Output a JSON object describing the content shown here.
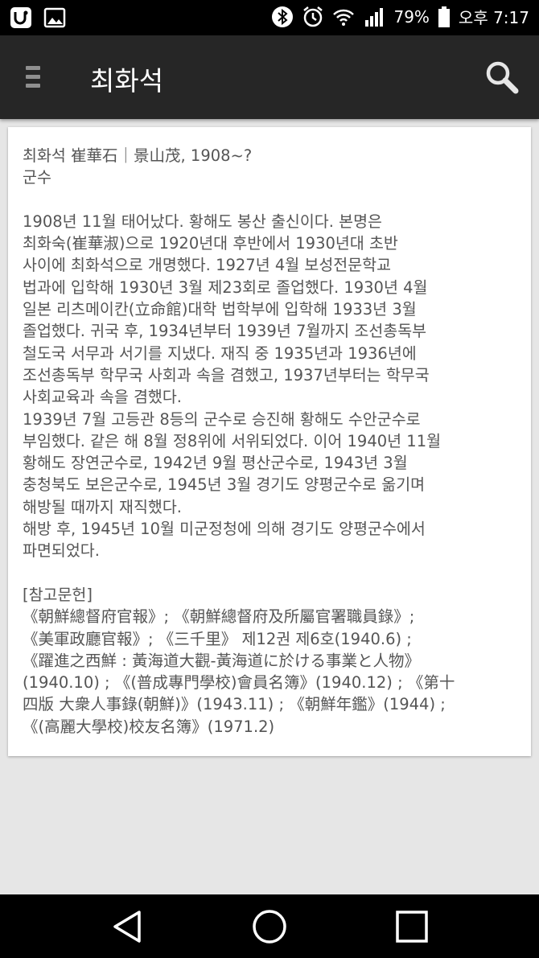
{
  "status_bar": {
    "icons_left": [
      "uplus-icon",
      "image-icon"
    ],
    "icons_right": [
      "bluetooth-icon",
      "alarm-icon",
      "wifi-icon",
      "signal-icon",
      "battery-icon"
    ],
    "battery": "79%",
    "time": "오후 7:17"
  },
  "appbar": {
    "title": "최화석",
    "menu_icon": "hamburger-menu-icon",
    "search_icon": "search-icon"
  },
  "article": {
    "lines": [
      "최화석 崔華石｜景山茂, 1908~?",
      "군수",
      "",
      "1908년 11월 태어났다. 황해도 봉산 출신이다. 본명은",
      "최화숙(崔華淑)으로 1920년대 후반에서 1930년대 초반",
      "사이에 최화석으로 개명했다. 1927년 4월 보성전문학교",
      "법과에 입학해 1930년 3월 제23회로 졸업했다. 1930년 4월",
      "일본 리츠메이칸(立命館)대학 법학부에 입학해 1933년 3월",
      "졸업했다. 귀국 후, 1934년부터 1939년 7월까지 조선총독부",
      "철도국 서무과 서기를 지냈다. 재직 중 1935년과 1936년에",
      "조선총독부 학무국 사회과 속을 겸했고, 1937년부터는 학무국",
      "사회교육과 속을 겸했다.",
      "1939년 7월 고등관 8등의 군수로 승진해 황해도 수안군수로",
      "부임했다. 같은 해 8월 정8위에 서위되었다. 이어 1940년 11월",
      "황해도 장연군수로, 1942년 9월 평산군수로, 1943년 3월",
      "충청북도 보은군수로, 1945년 3월 경기도 양평군수로 옮기며",
      "해방될 때까지 재직했다.",
      "해방 후, 1945년 10월 미군정청에 의해 경기도 양평군수에서",
      "파면되었다.",
      "",
      "[참고문헌]",
      "《朝鮮總督府官報》; 《朝鮮總督府及所屬官署職員錄》;",
      "《美軍政廳官報》; 《三千里》 제12권 제6호(1940.6) ;",
      "《躍進之西鮮 : 黃海道大觀-黃海道に於ける事業と人物》",
      "(1940.10) ; 《(普成專門學校)會員名簿》(1940.12) ; 《第十",
      "四版 大衆人事錄(朝鮮)》(1943.11) ; 《朝鮮年鑑》(1944) ;",
      "《(高麗大學校)校友名簿》(1971.2)"
    ]
  },
  "navbar": {
    "buttons": [
      "back-icon",
      "home-icon",
      "recents-icon"
    ]
  }
}
